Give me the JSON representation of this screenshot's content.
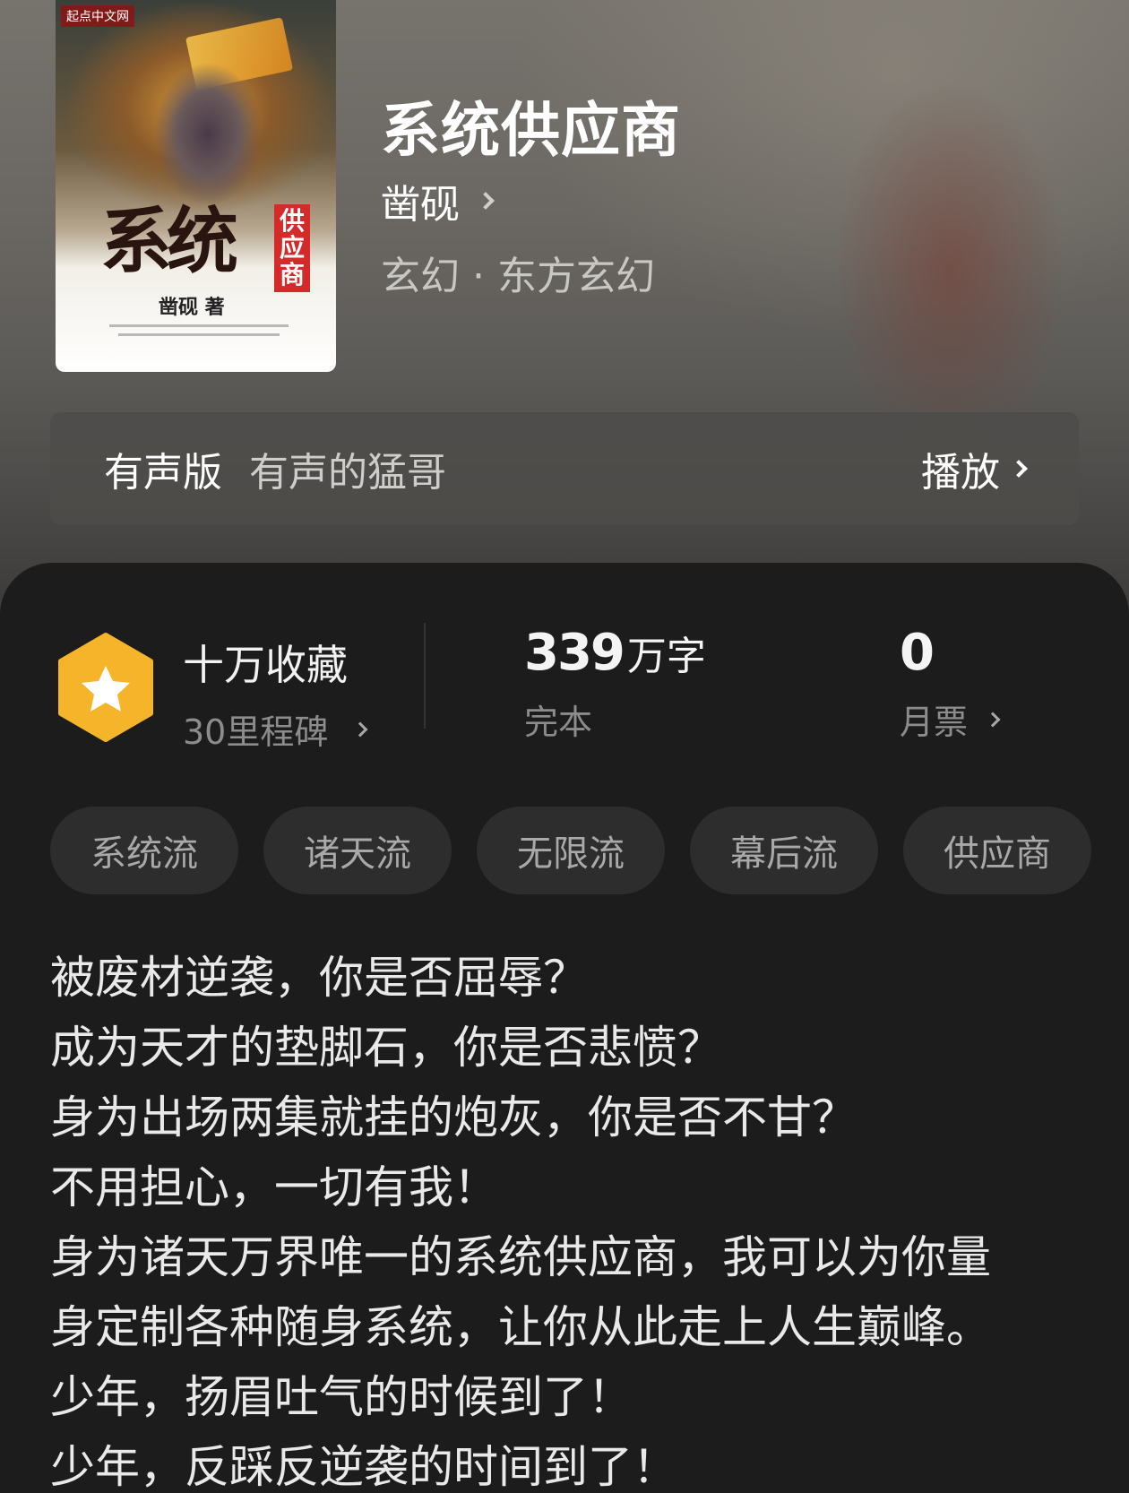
{
  "book": {
    "title": "系统供应商",
    "author": "凿砚",
    "genre": "玄幻 · 东方玄幻"
  },
  "cover": {
    "publisher": "起点中文网",
    "title": "系统",
    "subtitle": "供应商",
    "author_credit": "凿砚 著"
  },
  "audio": {
    "label": "有声版",
    "narrator": "有声的猛哥",
    "play_label": "播放"
  },
  "stats": {
    "collect": {
      "main": "十万收藏",
      "sub": "30里程碑"
    },
    "words": {
      "number": "339",
      "unit": "万字",
      "sub": "完本"
    },
    "votes": {
      "number": "0",
      "sub": "月票"
    }
  },
  "tags": [
    "系统流",
    "诸天流",
    "无限流",
    "幕后流",
    "供应商"
  ],
  "description": [
    "被废材逆袭，你是否屈辱？",
    "成为天才的垫脚石，你是否悲愤？",
    "身为出场两集就挂的炮灰，你是否不甘？",
    "不用担心，一切有我！",
    "身为诸天万界唯一的系统供应商，我可以为你量",
    "身定制各种随身系统，让你从此走上人生巅峰。",
    "少年，扬眉吐气的时候到了！",
    "少年，反踩反逆袭的时间到了！"
  ],
  "colors": {
    "badge": "#f6b42a",
    "panel": "#1c1c1c",
    "tag_bg": "#2d2d2d"
  }
}
